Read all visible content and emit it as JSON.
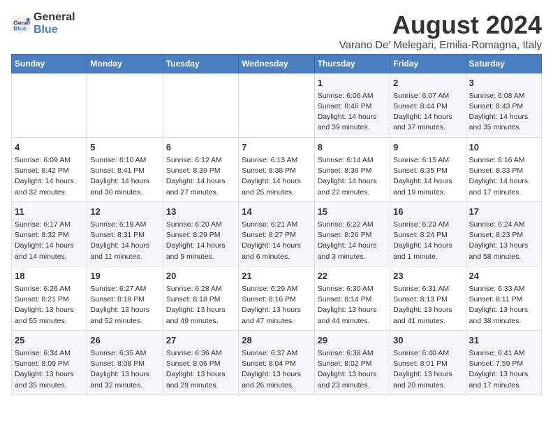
{
  "logo": {
    "line1": "General",
    "line2": "Blue"
  },
  "title": "August 2024",
  "subtitle": "Varano De' Melegari, Emilia-Romagna, Italy",
  "days_of_week": [
    "Sunday",
    "Monday",
    "Tuesday",
    "Wednesday",
    "Thursday",
    "Friday",
    "Saturday"
  ],
  "weeks": [
    [
      {
        "day": "",
        "content": ""
      },
      {
        "day": "",
        "content": ""
      },
      {
        "day": "",
        "content": ""
      },
      {
        "day": "",
        "content": ""
      },
      {
        "day": "1",
        "content": "Sunrise: 6:06 AM\nSunset: 8:46 PM\nDaylight: 14 hours\nand 39 minutes."
      },
      {
        "day": "2",
        "content": "Sunrise: 6:07 AM\nSunset: 8:44 PM\nDaylight: 14 hours\nand 37 minutes."
      },
      {
        "day": "3",
        "content": "Sunrise: 6:08 AM\nSunset: 8:43 PM\nDaylight: 14 hours\nand 35 minutes."
      }
    ],
    [
      {
        "day": "4",
        "content": "Sunrise: 6:09 AM\nSunset: 8:42 PM\nDaylight: 14 hours\nand 32 minutes."
      },
      {
        "day": "5",
        "content": "Sunrise: 6:10 AM\nSunset: 8:41 PM\nDaylight: 14 hours\nand 30 minutes."
      },
      {
        "day": "6",
        "content": "Sunrise: 6:12 AM\nSunset: 8:39 PM\nDaylight: 14 hours\nand 27 minutes."
      },
      {
        "day": "7",
        "content": "Sunrise: 6:13 AM\nSunset: 8:38 PM\nDaylight: 14 hours\nand 25 minutes."
      },
      {
        "day": "8",
        "content": "Sunrise: 6:14 AM\nSunset: 8:36 PM\nDaylight: 14 hours\nand 22 minutes."
      },
      {
        "day": "9",
        "content": "Sunrise: 6:15 AM\nSunset: 8:35 PM\nDaylight: 14 hours\nand 19 minutes."
      },
      {
        "day": "10",
        "content": "Sunrise: 6:16 AM\nSunset: 8:33 PM\nDaylight: 14 hours\nand 17 minutes."
      }
    ],
    [
      {
        "day": "11",
        "content": "Sunrise: 6:17 AM\nSunset: 8:32 PM\nDaylight: 14 hours\nand 14 minutes."
      },
      {
        "day": "12",
        "content": "Sunrise: 6:19 AM\nSunset: 8:31 PM\nDaylight: 14 hours\nand 11 minutes."
      },
      {
        "day": "13",
        "content": "Sunrise: 6:20 AM\nSunset: 8:29 PM\nDaylight: 14 hours\nand 9 minutes."
      },
      {
        "day": "14",
        "content": "Sunrise: 6:21 AM\nSunset: 8:27 PM\nDaylight: 14 hours\nand 6 minutes."
      },
      {
        "day": "15",
        "content": "Sunrise: 6:22 AM\nSunset: 8:26 PM\nDaylight: 14 hours\nand 3 minutes."
      },
      {
        "day": "16",
        "content": "Sunrise: 6:23 AM\nSunset: 8:24 PM\nDaylight: 14 hours\nand 1 minute."
      },
      {
        "day": "17",
        "content": "Sunrise: 6:24 AM\nSunset: 8:23 PM\nDaylight: 13 hours\nand 58 minutes."
      }
    ],
    [
      {
        "day": "18",
        "content": "Sunrise: 6:26 AM\nSunset: 8:21 PM\nDaylight: 13 hours\nand 55 minutes."
      },
      {
        "day": "19",
        "content": "Sunrise: 6:27 AM\nSunset: 8:19 PM\nDaylight: 13 hours\nand 52 minutes."
      },
      {
        "day": "20",
        "content": "Sunrise: 6:28 AM\nSunset: 8:18 PM\nDaylight: 13 hours\nand 49 minutes."
      },
      {
        "day": "21",
        "content": "Sunrise: 6:29 AM\nSunset: 8:16 PM\nDaylight: 13 hours\nand 47 minutes."
      },
      {
        "day": "22",
        "content": "Sunrise: 6:30 AM\nSunset: 8:14 PM\nDaylight: 13 hours\nand 44 minutes."
      },
      {
        "day": "23",
        "content": "Sunrise: 6:31 AM\nSunset: 8:13 PM\nDaylight: 13 hours\nand 41 minutes."
      },
      {
        "day": "24",
        "content": "Sunrise: 6:33 AM\nSunset: 8:11 PM\nDaylight: 13 hours\nand 38 minutes."
      }
    ],
    [
      {
        "day": "25",
        "content": "Sunrise: 6:34 AM\nSunset: 8:09 PM\nDaylight: 13 hours\nand 35 minutes."
      },
      {
        "day": "26",
        "content": "Sunrise: 6:35 AM\nSunset: 8:08 PM\nDaylight: 13 hours\nand 32 minutes."
      },
      {
        "day": "27",
        "content": "Sunrise: 6:36 AM\nSunset: 8:06 PM\nDaylight: 13 hours\nand 29 minutes."
      },
      {
        "day": "28",
        "content": "Sunrise: 6:37 AM\nSunset: 8:04 PM\nDaylight: 13 hours\nand 26 minutes."
      },
      {
        "day": "29",
        "content": "Sunrise: 6:38 AM\nSunset: 8:02 PM\nDaylight: 13 hours\nand 23 minutes."
      },
      {
        "day": "30",
        "content": "Sunrise: 6:40 AM\nSunset: 8:01 PM\nDaylight: 13 hours\nand 20 minutes."
      },
      {
        "day": "31",
        "content": "Sunrise: 6:41 AM\nSunset: 7:59 PM\nDaylight: 13 hours\nand 17 minutes."
      }
    ]
  ]
}
